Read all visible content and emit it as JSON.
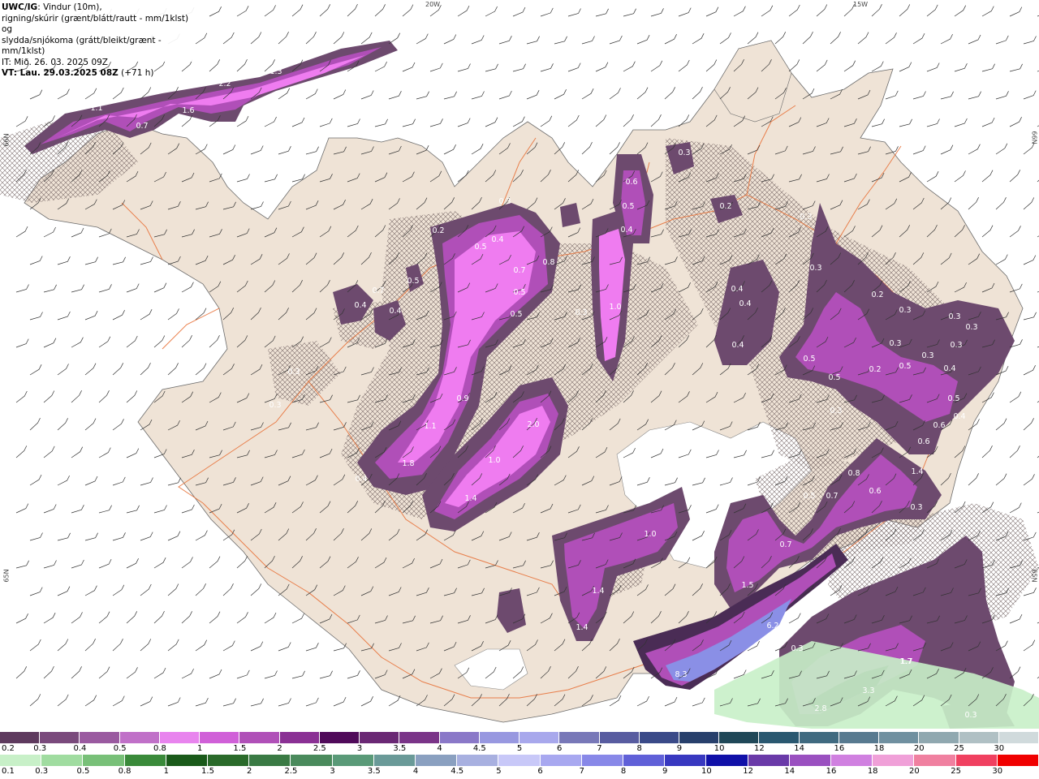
{
  "header": {
    "model": "UWC/IG",
    "line1_rest": ": Vindur (10m),",
    "line2": "rigning/skúrir (grænt/blátt/rautt - mm/1klst) og",
    "line3": "slydda/snjókoma (grátt/bleikt/grænt - mm/1klst)",
    "issue": "IT: Mið. 26. 03. 2025 09Z",
    "valid_bold": "VT: Lau. 29.03.2025 08Z",
    "valid_rest": " (+71 h)"
  },
  "grid_labels": {
    "top_left": "20W",
    "top_right": "15W",
    "right_top": "66N",
    "left_top": "66N",
    "left_mid": "65N",
    "right_mid": "65N"
  },
  "colors": {
    "land": "#efe3d6",
    "sea": "#ffffff",
    "roads": "#e8743c",
    "glacier": "#ffffff",
    "snow_light": "#6d4a6e",
    "snow_mid": "#b04fb8",
    "snow_bright": "#ef7cf0",
    "snow_heavy": "#4a2c55",
    "snow_blue": "#8a8fe6",
    "rain_light": "#c8f0c8"
  },
  "snow_legend": {
    "labels": [
      "0.2",
      "0.3",
      "0.4",
      "0.5",
      "0.8",
      "1",
      "1.5",
      "2",
      "2.5",
      "3",
      "3.5",
      "4",
      "4.5",
      "5",
      "6",
      "7",
      "8",
      "9",
      "10",
      "12",
      "14",
      "16",
      "18",
      "20",
      "25",
      "30"
    ],
    "colors": [
      "#5e3a5e",
      "#7a4a7c",
      "#9a5aa0",
      "#c070c8",
      "#e884ee",
      "#d060d8",
      "#b050b8",
      "#8a3094",
      "#500a5a",
      "#6a2874",
      "#7a3488",
      "#8a78c8",
      "#9898e0",
      "#a8a8ec",
      "#7878b8",
      "#585ca0",
      "#3a4a88",
      "#28406c",
      "#204858",
      "#2a5870",
      "#406a80",
      "#587a90",
      "#7090a0",
      "#90a8b0",
      "#b0c0c4",
      "#d0dadc"
    ]
  },
  "rain_legend": {
    "labels": [
      "0.1",
      "0.3",
      "0.5",
      "0.8",
      "1",
      "1.5",
      "2",
      "2.5",
      "3",
      "3.5",
      "4",
      "4.5",
      "5",
      "6",
      "7",
      "8",
      "9",
      "10",
      "12",
      "14",
      "16",
      "18",
      "20",
      "25",
      "30"
    ],
    "colors": [
      "#c8f0c8",
      "#a0dca0",
      "#78c078",
      "#3a8a3a",
      "#1a5a1a",
      "#2a6a2a",
      "#3a7a44",
      "#4a8a5c",
      "#5a9a78",
      "#6a9a98",
      "#8aa0c0",
      "#a8b0e0",
      "#c8c8f8",
      "#a8a8f0",
      "#8888e8",
      "#6060d8",
      "#3838c0",
      "#1010a8",
      "#6a3aa8",
      "#9a50c0",
      "#d080e0",
      "#f0a0d8",
      "#f080a0",
      "#f04060",
      "#f00000"
    ]
  },
  "map_values": [
    {
      "v": "2.2"
    },
    {
      "v": "1.3"
    },
    {
      "v": "1.1"
    },
    {
      "v": "1.6"
    },
    {
      "v": "0.7"
    },
    {
      "v": "0.6"
    },
    {
      "v": "0.5"
    },
    {
      "v": "0.4"
    },
    {
      "v": "0.3"
    },
    {
      "v": "1.0"
    },
    {
      "v": "0.3"
    },
    {
      "v": "0.2"
    },
    {
      "v": "0.3"
    },
    {
      "v": "0.3"
    },
    {
      "v": "0.2"
    },
    {
      "v": "0.2"
    },
    {
      "v": "0.5"
    },
    {
      "v": "0.4"
    },
    {
      "v": "0.7"
    },
    {
      "v": "0.5"
    },
    {
      "v": "0.8"
    },
    {
      "v": "0.7"
    },
    {
      "v": "0.5"
    },
    {
      "v": "0.5"
    },
    {
      "v": "0.3"
    },
    {
      "v": "0.9"
    },
    {
      "v": "2.0"
    },
    {
      "v": "1.1"
    },
    {
      "v": "1.8"
    },
    {
      "v": "1.0"
    },
    {
      "v": "1.4"
    },
    {
      "v": "0.4"
    },
    {
      "v": "0.7"
    },
    {
      "v": "0.4"
    },
    {
      "v": "0.4"
    },
    {
      "v": "0.4"
    },
    {
      "v": "0.3"
    },
    {
      "v": "0.5"
    },
    {
      "v": "0.3"
    },
    {
      "v": "0.3"
    },
    {
      "v": "0.3"
    },
    {
      "v": "0.3"
    },
    {
      "v": "0.2"
    },
    {
      "v": "0.3"
    },
    {
      "v": "0.3"
    },
    {
      "v": "0.5"
    },
    {
      "v": "0.5"
    },
    {
      "v": "0.4"
    },
    {
      "v": "0.5"
    },
    {
      "v": "0.6"
    },
    {
      "v": "0.6"
    },
    {
      "v": "1.4"
    },
    {
      "v": "0.3"
    },
    {
      "v": "0.8"
    },
    {
      "v": "0.4"
    },
    {
      "v": "0.5"
    },
    {
      "v": "0.7"
    },
    {
      "v": "0.6"
    },
    {
      "v": "1.0"
    },
    {
      "v": "1.4"
    },
    {
      "v": "1.4"
    },
    {
      "v": "1.7"
    },
    {
      "v": "1.5"
    },
    {
      "v": "6.2"
    },
    {
      "v": "8.3"
    },
    {
      "v": "0.3"
    },
    {
      "v": "1.7"
    },
    {
      "v": "3.3"
    },
    {
      "v": "2.8"
    },
    {
      "v": "0.3"
    },
    {
      "v": "0.3"
    },
    {
      "v": "0.3"
    },
    {
      "v": "0.4"
    },
    {
      "v": "0.4"
    }
  ]
}
